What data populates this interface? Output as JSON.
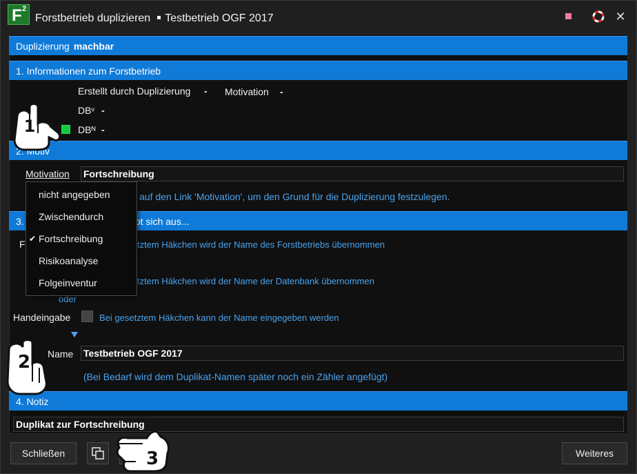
{
  "window": {
    "title": "Forstbetrieb duplizieren",
    "subtitle": "Testbetrieb OGF 2017",
    "logo_letter": "F",
    "logo_sup": "2"
  },
  "status_bar": {
    "label": "Duplizierung",
    "value": "machbar"
  },
  "section1": {
    "header": "1. Informationen zum Forstbetrieb",
    "created_label": "Erstellt durch Duplizierung",
    "created_value": "-",
    "motivation_label": "Motivation",
    "motivation_value": "-",
    "dbv_label": "DBᵛ",
    "dbv_value": "-",
    "dbn_label": "DBᴺ",
    "dbn_value": "-"
  },
  "section2": {
    "header": "2. Motiv",
    "motivation_link": "Motivation",
    "motivation_value": "Fortschreibung",
    "hint": "auf den Link 'Motivation', um den Grund für die Duplizierung festzulegen."
  },
  "dropdown": {
    "options": [
      "nicht angegeben",
      "Zwischendurch",
      "Fortschreibung",
      "Risikoanalyse",
      "Folgeinventur"
    ],
    "selected": "Fortschreibung",
    "check": "✔"
  },
  "section3": {
    "header_tail": "gibt sich aus...",
    "row1_hint": "tztem Häkchen wird der Name des Forstbetriebs übernommen",
    "row2_hint": "tztem Häkchen wird der Name der Datenbank übernommen",
    "oder": "oder",
    "manual_label": "Handeingabe",
    "manual_hint": "Bei gesetztem Häkchen kann der Name eingegeben werden",
    "name_label": "Name",
    "name_value": "Testbetrieb OGF 2017",
    "name_note": "(Bei Bedarf wird dem Duplikat-Namen später noch ein Zähler angefügt)"
  },
  "section4": {
    "header": "4. Notiz",
    "note_value": "Duplikat zur Fortschreibung"
  },
  "buttons": {
    "close": "Schließen",
    "more": "Weiteres"
  },
  "annotations": {
    "hand1": "1",
    "hand2": "2",
    "hand3": "3"
  },
  "colors": {
    "accent": "#0f7ad8",
    "link_blue": "#4aa3ee",
    "check_green": "#17c940"
  }
}
